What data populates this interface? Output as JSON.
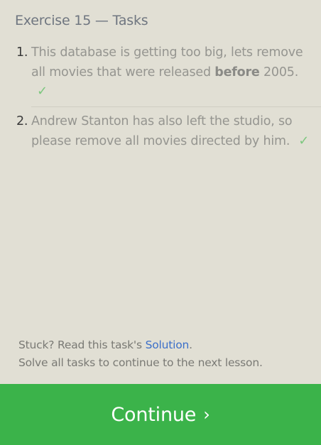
{
  "header": {
    "title": "Exercise 15 — Tasks"
  },
  "tasks": [
    {
      "number": "1.",
      "text_before": "This database is getting too big, lets remove all movies that were released ",
      "text_bold": "before",
      "text_after": " 2005.",
      "check": "✓",
      "completed": true
    },
    {
      "number": "2.",
      "text": "Andrew Stanton has also left the studio, so please remove all movies directed by him.",
      "check": "✓",
      "completed": true
    }
  ],
  "help": {
    "stuck_prefix": "Stuck? Read this task's ",
    "solution_link": "Solution",
    "stuck_suffix": ".",
    "instruction": "Solve all tasks to continue to the next lesson."
  },
  "footer": {
    "continue_label": "Continue",
    "continue_chevron": "›"
  },
  "colors": {
    "background": "#e1dfd4",
    "check": "#7cc77e",
    "link": "#3b6fc9",
    "continue_bg": "#3bb34a"
  }
}
